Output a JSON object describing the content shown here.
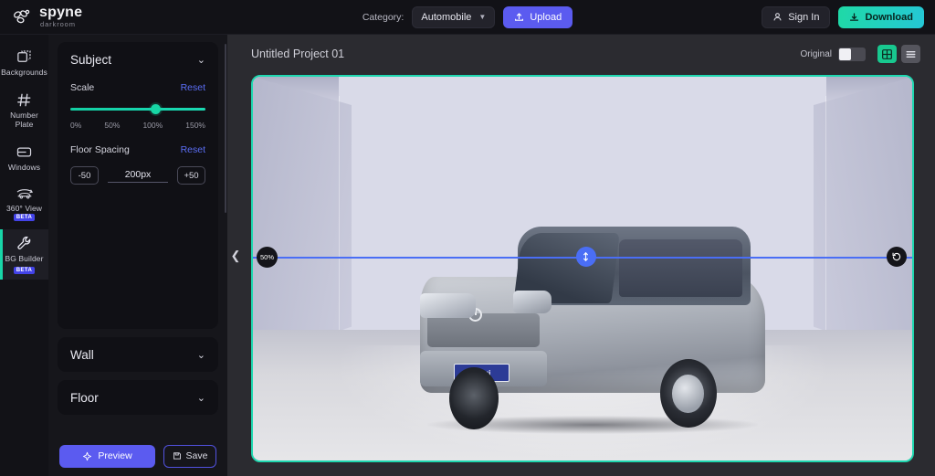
{
  "topbar": {
    "logo_name": "spyne",
    "logo_sub": "darkroom",
    "logo_icon": "spyne-flower-logo-icon",
    "category_label": "Category:",
    "category_value": "Automobile",
    "category_chevron_icon": "chevron-down-icon",
    "upload_label": "Upload",
    "upload_icon": "upload-icon",
    "upload_color": "#5b5bf0",
    "signin_label": "Sign In",
    "signin_icon": "user-icon",
    "download_label": "Download",
    "download_icon": "download-icon",
    "download_color": "#1fd9a6"
  },
  "sidebar": {
    "items": [
      {
        "label": "Backgrounds",
        "icon": "backgrounds-frame-icon",
        "badge": "",
        "active": false
      },
      {
        "label": "Number Plate",
        "icon": "hash-number-plate-icon",
        "badge": "",
        "active": false
      },
      {
        "label": "Windows",
        "icon": "windows-panel-icon",
        "badge": "",
        "active": false
      },
      {
        "label": "360° View",
        "icon": "car-360-icon",
        "badge": "BETA",
        "active": false
      },
      {
        "label": "BG Builder",
        "icon": "wrench-tool-icon",
        "badge": "BETA",
        "active": true
      }
    ],
    "active_indicator_color": "#18d6a8",
    "badge_color": "#4343e8"
  },
  "panel": {
    "sections": [
      {
        "title": "Subject",
        "expanded": true,
        "chevron_icon": "chevron-down-icon",
        "controls": {
          "scale": {
            "label": "Scale",
            "reset_label": "Reset",
            "value_percent": 95,
            "ticks": [
              "0%",
              "50%",
              "100%",
              "150%"
            ],
            "track_color": "#17d6a5"
          },
          "floor_spacing": {
            "label": "Floor Spacing",
            "reset_label": "Reset",
            "decrement_label": "-50",
            "value": "200px",
            "increment_label": "+50"
          }
        }
      },
      {
        "title": "Wall",
        "expanded": false,
        "chevron_icon": "chevron-down-icon"
      },
      {
        "title": "Floor",
        "expanded": false,
        "chevron_icon": "chevron-down-icon"
      }
    ],
    "actions": {
      "preview_label": "Preview",
      "preview_icon": "sparkle-icon",
      "save_label": "Save",
      "save_icon": "floppy-disk-icon"
    }
  },
  "stage": {
    "project_title": "Untitled Project 01",
    "original_toggle_label": "Original",
    "original_toggle_on": false,
    "grid_view_icon": "grid-view-icon",
    "list_view_icon": "list-view-icon",
    "grid_view_active": true,
    "collapse_icon": "chevron-left-icon",
    "canvas_border_color": "#1fd8b0",
    "horizon": {
      "percent_badge": "50%",
      "line_color": "#4a6ef5",
      "move_handle_icon": "vertical-move-arrows-icon",
      "reset_icon": "rotate-ccw-reset-icon"
    },
    "vehicle": {
      "license_plate_text": "karvi"
    }
  }
}
